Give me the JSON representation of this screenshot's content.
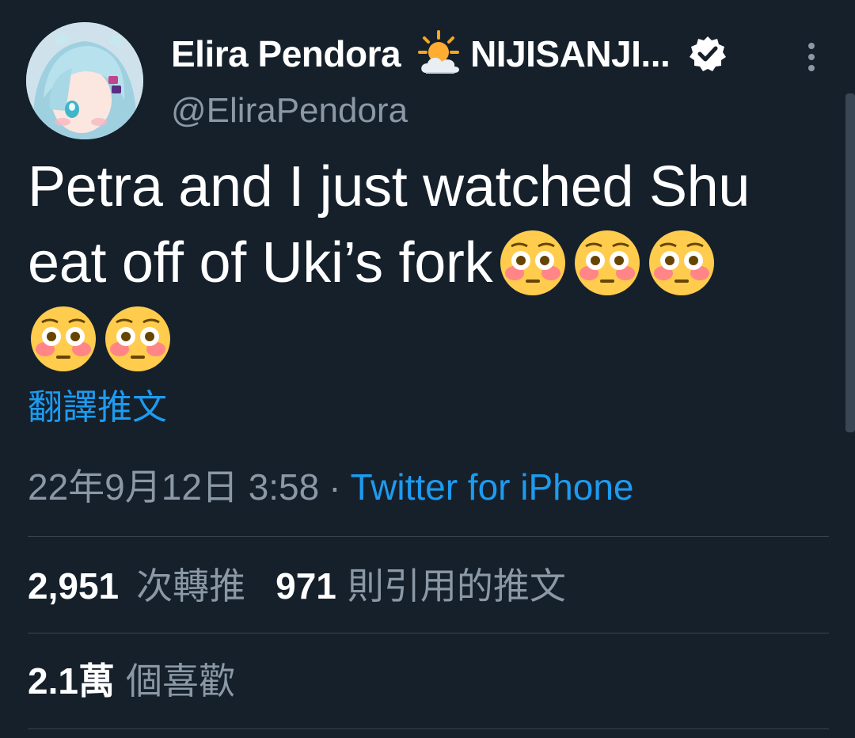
{
  "author": {
    "display_name": "Elira Pendora",
    "name_suffix": "NIJISANJI...",
    "handle": "@EliraPendora",
    "name_icon": "sun-behind-cloud-icon",
    "verified_icon": "verified-badge-icon",
    "avatar_icon": "avatar-image"
  },
  "tweet": {
    "line1": "Petra and I just watched Shu",
    "line2": "eat off of Uki’s fork",
    "emoji": "flushed-face-icon",
    "translate_label": "翻譯推文",
    "timestamp": "22年9月12日 3:58",
    "separator": "·",
    "source": "Twitter for iPhone"
  },
  "stats": {
    "retweets_count": "2,951",
    "retweets_label": "次轉推",
    "quotes_count": "971",
    "quotes_label": "則引用的推文",
    "likes_count": "2.1萬",
    "likes_label": "個喜歡"
  },
  "colors": {
    "background": "#15202b",
    "text_primary": "#ffffff",
    "text_secondary": "#8b98a5",
    "link": "#1d9bf0",
    "divider": "#38444d"
  }
}
